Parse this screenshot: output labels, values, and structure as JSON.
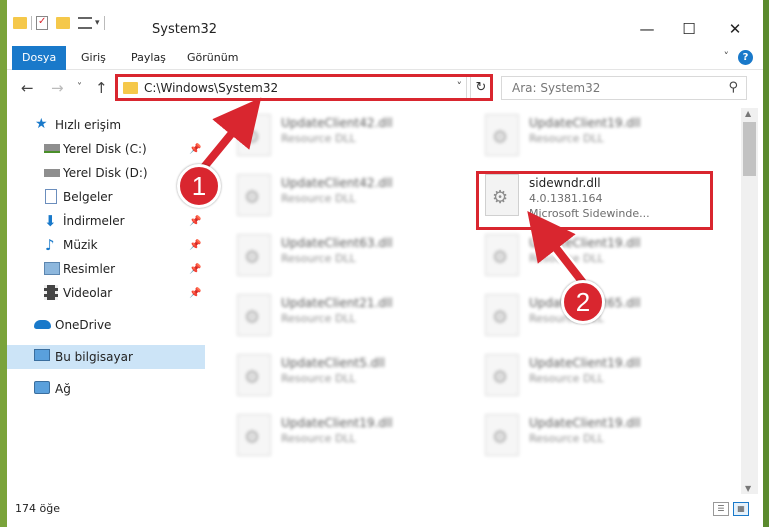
{
  "window": {
    "title": "System32",
    "minimize_glyph": "—",
    "maximize_glyph": "☐",
    "close_glyph": "✕"
  },
  "ribbon": {
    "tabs": [
      "Dosya",
      "Giriş",
      "Paylaş",
      "Görünüm"
    ],
    "help_glyph": "?",
    "collapse_glyph": "˅"
  },
  "navigation": {
    "back_glyph": "←",
    "forward_glyph": "→",
    "recent_glyph": "˅",
    "up_glyph": "↑",
    "address_path": "C:\\Windows\\System32",
    "address_dropdown_glyph": "˅",
    "refresh_glyph": "↻",
    "search_placeholder": "Ara: System32",
    "search_glyph": "⚲"
  },
  "sidebar": {
    "items": [
      {
        "label": "Hızlı erişim",
        "icon": "star-icon",
        "pinned": false
      },
      {
        "label": "Yerel Disk (C:)",
        "icon": "drive-icon",
        "pinned": true
      },
      {
        "label": "Yerel Disk (D:)",
        "icon": "drive-icon",
        "pinned": true
      },
      {
        "label": "Belgeler",
        "icon": "documents-icon",
        "pinned": false
      },
      {
        "label": "İndirmeler",
        "icon": "download-icon",
        "pinned": true
      },
      {
        "label": "Müzik",
        "icon": "music-icon",
        "pinned": true
      },
      {
        "label": "Resimler",
        "icon": "pictures-icon",
        "pinned": true
      },
      {
        "label": "Videolar",
        "icon": "videos-icon",
        "pinned": true
      },
      {
        "label": "OneDrive",
        "icon": "cloud-icon",
        "pinned": false
      },
      {
        "label": "Bu bilgisayar",
        "icon": "computer-icon",
        "pinned": false
      },
      {
        "label": "Ağ",
        "icon": "network-icon",
        "pinned": false
      }
    ],
    "pin_glyph": "📌"
  },
  "files": {
    "left_column": [
      {
        "name": "UpdateClient42.dll",
        "type": "Resource DLL"
      },
      {
        "name": "UpdateClient42.dll",
        "type": "Resource DLL"
      },
      {
        "name": "UpdateClient63.dll",
        "type": "Resource DLL"
      },
      {
        "name": "UpdateClient21.dll",
        "type": "Resource DLL"
      },
      {
        "name": "UpdateClient5.dll",
        "type": "Resource DLL"
      },
      {
        "name": "UpdateClient19.dll",
        "type": "Resource DLL"
      }
    ],
    "right_column": [
      {
        "name": "UpdateClient19.dll",
        "type": "Resource DLL"
      },
      {
        "name": "UpdateClient19.dll",
        "type": "Resource DLL"
      },
      {
        "name": "UpdateClient65.dll",
        "type": "Resource DLL"
      },
      {
        "name": "UpdateClient19.dll",
        "type": "Resource DLL"
      },
      {
        "name": "UpdateClient19.dll",
        "type": "Resource DLL"
      }
    ],
    "highlighted": {
      "name": "sidewndr.dll",
      "version": "4.0.1381.164",
      "description": "Microsoft Sidewinde..."
    }
  },
  "status": {
    "item_count": "174 öğe"
  },
  "annotations": {
    "callout_1": "1",
    "callout_2": "2",
    "highlight_color": "#d9262f"
  },
  "colors": {
    "accent": "#1979ca",
    "selection": "#cce4f7",
    "desktop_left": "#7aa33a"
  }
}
